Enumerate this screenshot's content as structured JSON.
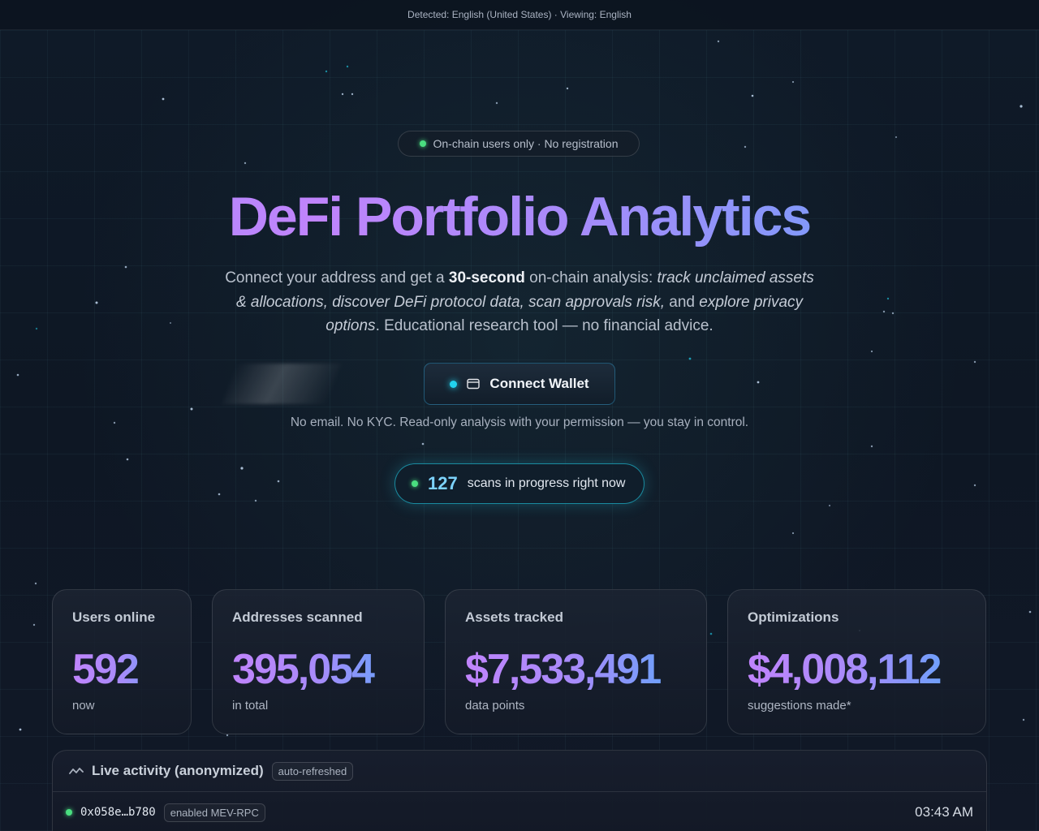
{
  "lang_bar": {
    "text": "Detected: English (United States) · Viewing: English"
  },
  "hero": {
    "badge": "On-chain users only · No registration",
    "title": "DeFi Portfolio Analytics",
    "desc": {
      "p1": "Connect your address and get a ",
      "b1": "30-second",
      "p2": " on-chain analysis: ",
      "i1": "track unclaimed assets & allocations, discover DeFi protocol data, scan approvals risk,",
      "p3": " and ",
      "i2": "explore privacy options",
      "p4": ". Educational research tool — no financial advice."
    },
    "connect_label": "Connect Wallet",
    "note": "No email. No KYC. Read-only analysis with your permission — you stay in control.",
    "scans_count": "127",
    "scans_text": "scans in progress right now"
  },
  "stats": [
    {
      "label": "Users online",
      "value": "592",
      "sub": "now"
    },
    {
      "label": "Addresses scanned",
      "value": "395,054",
      "sub": "in total"
    },
    {
      "label": "Assets tracked",
      "value": "$7,533,491",
      "sub": "data points"
    },
    {
      "label": "Optimizations",
      "value": "$4,008,112",
      "sub": "suggestions made*"
    }
  ],
  "activity": {
    "title": "Live activity (anonymized)",
    "tag": "auto-refreshed",
    "rows": [
      {
        "address": "0x058e…b780",
        "action": "enabled MEV-RPC",
        "time": "03:43 AM"
      }
    ]
  },
  "icons": {
    "badge_dot": "status-dot-icon",
    "connect_dot": "status-dot-icon",
    "wallet": "wallet-icon",
    "pulse": "activity-pulse-icon"
  },
  "colors": {
    "accent_cyan": "#22d3ee",
    "status_green": "#4ade80",
    "gradient_purple": "#c084fc",
    "gradient_blue": "#60a5fa"
  }
}
